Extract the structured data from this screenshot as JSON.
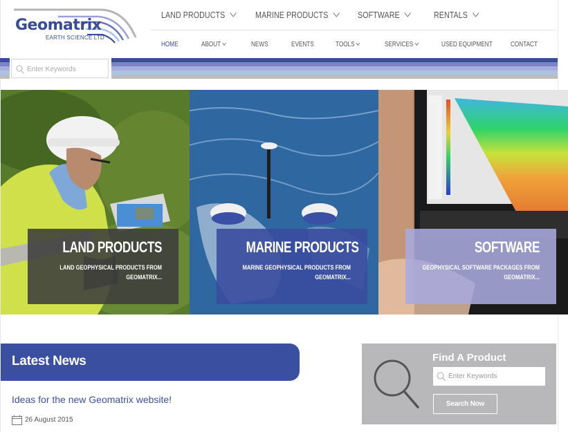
{
  "brand": {
    "name": "Geomatrix",
    "tagline": "EARTH SCIENCE LTD",
    "colors": {
      "primary": "#3b4fa0",
      "stripe_1": "#3b4c9a",
      "stripe_2": "#7b84c6",
      "stripe_3": "#a8addb",
      "stripe_4": "#aac4e6",
      "stripe_5": "#bdbdbd",
      "find_box_bg": "#b8b8bb"
    }
  },
  "main_nav": [
    {
      "label": "LAND PRODUCTS",
      "icon": "chevron-down-icon"
    },
    {
      "label": "MARINE PRODUCTS",
      "icon": "chevron-down-icon"
    },
    {
      "label": "SOFTWARE",
      "icon": "chevron-down-icon"
    },
    {
      "label": "RENTALS",
      "icon": "chevron-down-icon"
    }
  ],
  "sub_nav": [
    {
      "label": "HOME",
      "active": true
    },
    {
      "label": "ABOUT",
      "icon": "chevron-down-icon"
    },
    {
      "label": "NEWS"
    },
    {
      "label": "EVENTS"
    },
    {
      "label": "TOOLS",
      "icon": "chevron-down-icon"
    },
    {
      "label": "SERVICES",
      "icon": "chevron-down-icon"
    },
    {
      "label": "USED EQUIPMENT"
    },
    {
      "label": "CONTACT"
    }
  ],
  "header_search": {
    "placeholder": "Enter Keywords",
    "value": "",
    "icon": "search-icon"
  },
  "tiles": [
    {
      "title": "LAND PRODUCTS",
      "description": "LAND GEOPHYSICAL PRODUCTS FROM GEOMATRIX...",
      "image": "surveyor-in-hard-hat-with-instrument"
    },
    {
      "title": "MARINE PRODUCTS",
      "description": "MARINE GEOPHYSICAL PRODUCTS FROM GEOMATRIX...",
      "image": "towed-marine-sensor-on-water"
    },
    {
      "title": "SOFTWARE",
      "description": "GEOPHYSICAL SOFTWARE PACKAGES FROM GEOMATRIX...",
      "image": "laptop-showing-resistivity-section"
    }
  ],
  "latest_news": {
    "heading": "Latest News",
    "items": [
      {
        "title": "Ideas for the new Geomatrix website!",
        "date": "26 August 2015",
        "icon": "calendar-icon"
      }
    ]
  },
  "find_product": {
    "heading": "Find A Product",
    "placeholder": "Enter Keywords",
    "value": "",
    "button_label": "Search Now",
    "icon": "magnifier-icon"
  }
}
